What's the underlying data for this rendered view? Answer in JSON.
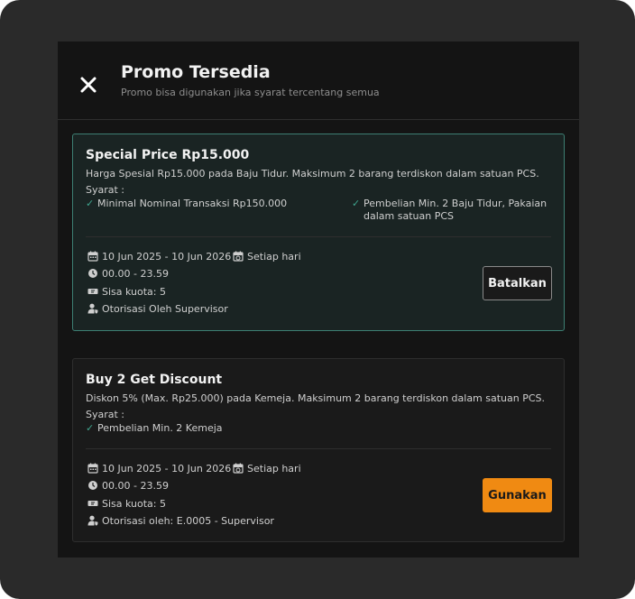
{
  "dialog": {
    "title": "Promo Tersedia",
    "subtitle": "Promo bisa digunakan jika syarat tercentang semua",
    "close_icon": "close-icon"
  },
  "colors": {
    "accent_orange": "#f08a12",
    "active_border": "#3d7f73",
    "check_green": "#3fa58e",
    "panel_bg": "#141414"
  },
  "promos": [
    {
      "title": "Special Price Rp15.000",
      "description": "Harga Spesial Rp15.000 pada Baju Tidur. Maksimum 2 barang terdiskon dalam satuan PCS.",
      "syarat_label": "Syarat :",
      "requirements": [
        "Minimal Nominal Transaksi Rp150.000",
        "Pembelian Min. 2 Baju Tidur, Pakaian dalam satuan PCS"
      ],
      "period": "10 Jun 2025 - 10 Jun 2026",
      "schedule": "Setiap hari",
      "time": "00.00 - 23.59",
      "quota": "Sisa kuota: 5",
      "authorization": "Otorisasi Oleh Supervisor",
      "button_label": "Batalkan",
      "state": "applied"
    },
    {
      "title": "Buy 2 Get Discount",
      "description": "Diskon 5% (Max. Rp25.000) pada Kemeja. Maksimum 2 barang terdiskon dalam satuan PCS.",
      "syarat_label": "Syarat :",
      "requirements": [
        "Pembelian Min. 2 Kemeja"
      ],
      "period": "10 Jun 2025 - 10 Jun 2026",
      "schedule": "Setiap hari",
      "time": "00.00 - 23.59",
      "quota": "Sisa kuota: 5",
      "authorization": "Otorisasi oleh: E.0005 - Supervisor",
      "button_label": "Gunakan",
      "state": "available"
    }
  ],
  "icons": {
    "check": "✓",
    "calendar": "calendar-icon",
    "calendar_repeat": "calendar-repeat-icon",
    "clock": "clock-icon",
    "ticket": "ticket-icon",
    "user": "user-shield-icon"
  }
}
